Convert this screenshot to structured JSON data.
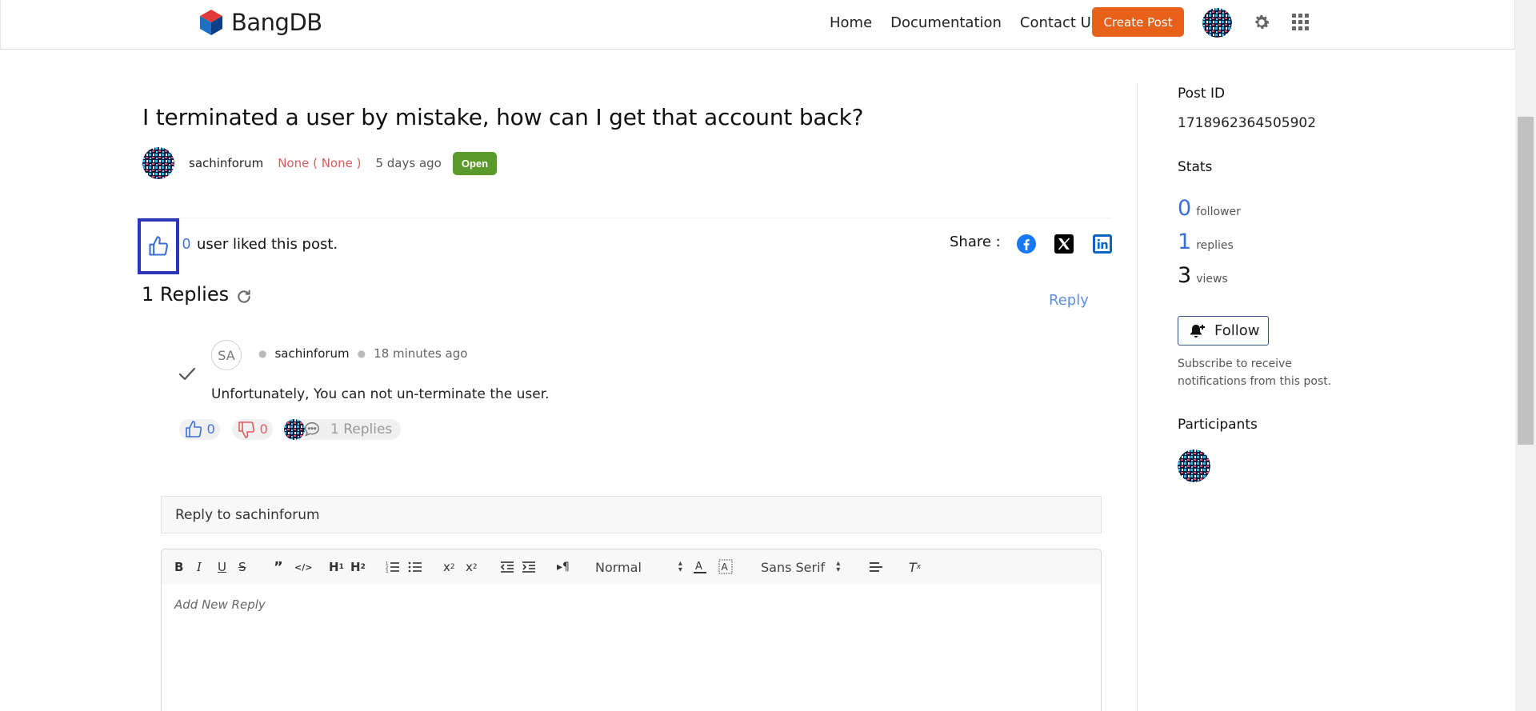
{
  "header": {
    "logo_text": "BangDB",
    "nav": [
      "Home",
      "Documentation",
      "Contact Us"
    ],
    "create_post": "Create Post"
  },
  "post": {
    "title": "I terminated a user by mistake, how can I get that account back?",
    "author": "sachinforum",
    "role": "None ( None )",
    "time_ago": "5 days ago",
    "status": "Open",
    "likes": "0",
    "likes_text": "user liked this post.",
    "share_label": "Share :"
  },
  "replies_section": {
    "heading": "1 Replies",
    "reply_link": "Reply",
    "items": [
      {
        "avatar_initials": "SA",
        "author": "sachinforum",
        "time_ago": "18 minutes ago",
        "body": "Unfortunately, You can not un-terminate the user.",
        "likes": "0",
        "dislikes": "0",
        "replies_label": "1 Replies"
      }
    ]
  },
  "reply_box": {
    "reply_to": "Reply to sachinforum",
    "placeholder": "Add New Reply",
    "header_select": "Normal",
    "font_select": "Sans Serif"
  },
  "sidebar": {
    "post_id_label": "Post ID",
    "post_id": "1718962364505902",
    "stats_label": "Stats",
    "followers": "0",
    "followers_label": "follower",
    "replies": "1",
    "replies_label": "replies",
    "views": "3",
    "views_label": "views",
    "follow_button": "Follow",
    "subscribe_text": "Subscribe to receive notifications from this post.",
    "participants_label": "Participants"
  },
  "colors": {
    "accent_orange": "#e8611a",
    "link_blue": "#3b6fd6",
    "status_green": "#5b9a2a",
    "role_red": "#e05a5a",
    "highlight_box": "#2b35b8"
  }
}
